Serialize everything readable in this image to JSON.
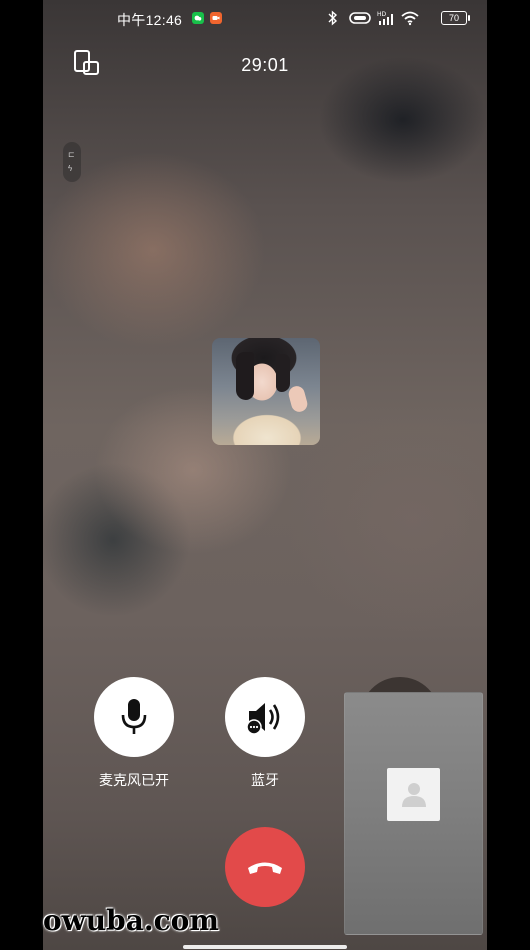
{
  "status_bar": {
    "time": "中午12:46",
    "notification_icons": [
      "wechat-icon",
      "video-app-icon"
    ],
    "status_icons": [
      "bluetooth-icon",
      "link-icon",
      "hd-signal-icon",
      "wifi-icon"
    ],
    "battery": "70"
  },
  "call": {
    "timer": "29:01"
  },
  "controls": {
    "mic_label": "麦克风已开",
    "speaker_label": "蓝牙"
  },
  "watermark": "owuba.com",
  "colors": {
    "hangup": "#e24a4a",
    "wechat_badge": "#18c04a",
    "video_badge": "#f0652e"
  }
}
